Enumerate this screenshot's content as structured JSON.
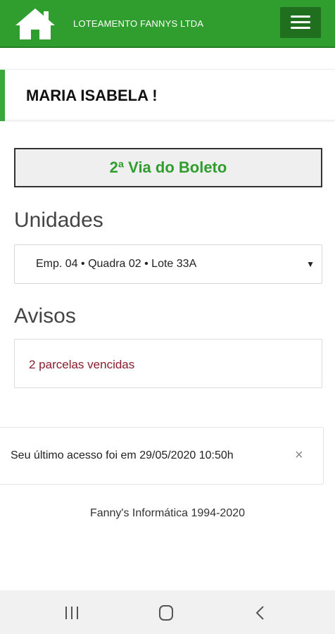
{
  "header": {
    "brand": "LOTEAMENTO FANNYS LTDA",
    "bg_color": "#2f9e2f",
    "home_icon": "home-icon",
    "menu_icon": "hamburger-menu-icon"
  },
  "welcome": {
    "name": "MARIA ISABELA !"
  },
  "actions": {
    "boleto_label": "2ª Via do Boleto"
  },
  "unidades": {
    "title": "Unidades",
    "selected": "Emp. 04 • Quadra 02 • Lote 33A"
  },
  "avisos": {
    "title": "Avisos",
    "message": "2 parcelas vencidas"
  },
  "last_access": {
    "message": "Seu último acesso foi em 29/05/2020 10:50h",
    "close_label": "×"
  },
  "footer": {
    "text": "Fanny's Informática 1994-2020"
  },
  "android_nav": {
    "recents_icon": "recents-icon",
    "home_icon": "home-circle-icon",
    "back_icon": "back-icon"
  }
}
